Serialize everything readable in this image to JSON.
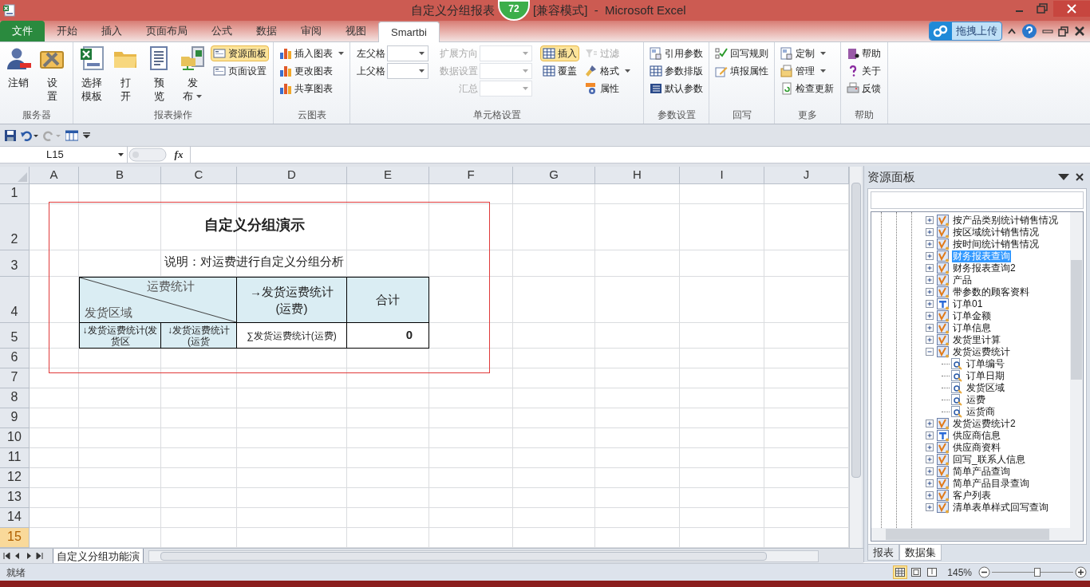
{
  "window": {
    "title": "自定义分组报表",
    "badge": "72",
    "title_rest": "[兼容模式]  -  Microsoft Excel"
  },
  "ribbon": {
    "tabs": [
      {
        "label": "文件",
        "kind": "file",
        "selected": false
      },
      {
        "label": "开始",
        "kind": "tab",
        "selected": false
      },
      {
        "label": "插入",
        "kind": "tab",
        "selected": false
      },
      {
        "label": "页面布局",
        "kind": "tab",
        "selected": false
      },
      {
        "label": "公式",
        "kind": "tab",
        "selected": false
      },
      {
        "label": "数据",
        "kind": "tab",
        "selected": false
      },
      {
        "label": "审阅",
        "kind": "tab",
        "selected": false
      },
      {
        "label": "视图",
        "kind": "tab",
        "selected": false
      },
      {
        "label": "Smartbi",
        "kind": "tab",
        "selected": true
      }
    ],
    "upload_button": "拖拽上传",
    "groups": [
      {
        "label": "服务器",
        "columns": [
          {
            "kind": "large",
            "lines": [
              "注销"
            ],
            "dropdown": false
          },
          {
            "kind": "large",
            "lines": [
              "设",
              "置"
            ],
            "dropdown": false
          }
        ]
      },
      {
        "label": "报表操作",
        "columns": [
          {
            "kind": "large",
            "lines": [
              "选择",
              "模板"
            ],
            "dropdown": false
          },
          {
            "kind": "large",
            "lines": [
              "打",
              "开"
            ],
            "dropdown": false
          },
          {
            "kind": "large",
            "lines": [
              "预",
              "览"
            ],
            "dropdown": false
          },
          {
            "kind": "large",
            "lines": [
              "发",
              "布"
            ],
            "dropdown": true
          },
          {
            "kind": "stack",
            "items": [
              {
                "label": "资源面板",
                "selected": true,
                "disabled": false,
                "dropdown": false
              },
              {
                "label": "页面设置",
                "selected": false,
                "disabled": false,
                "dropdown": false
              }
            ]
          }
        ]
      },
      {
        "label": "云图表",
        "columns": [
          {
            "kind": "stack",
            "items": [
              {
                "label": "插入图表",
                "selected": false,
                "disabled": false,
                "dropdown": true
              },
              {
                "label": "更改图表",
                "selected": false,
                "disabled": false,
                "dropdown": false
              },
              {
                "label": "共享图表",
                "selected": false,
                "disabled": false,
                "dropdown": false
              }
            ]
          }
        ]
      },
      {
        "label": "单元格设置",
        "columns": [
          {
            "kind": "fields",
            "items": [
              {
                "label": "左父格",
                "disabled": false
              },
              {
                "label": "上父格",
                "disabled": false
              }
            ]
          },
          {
            "kind": "fields",
            "items": [
              {
                "label": "扩展方向",
                "disabled": true
              },
              {
                "label": "数据设置",
                "disabled": true
              },
              {
                "label": "汇总",
                "disabled": true
              }
            ]
          },
          {
            "kind": "stack",
            "items": [
              {
                "label": "插入",
                "selected": true,
                "disabled": false,
                "dropdown": false
              },
              {
                "label": "覆盖",
                "selected": false,
                "disabled": false,
                "dropdown": false
              }
            ]
          },
          {
            "kind": "stack",
            "items": [
              {
                "label": "过滤",
                "selected": false,
                "disabled": true,
                "dropdown": false
              },
              {
                "label": "格式",
                "selected": false,
                "disabled": false,
                "dropdown": true
              },
              {
                "label": "属性",
                "selected": false,
                "disabled": false,
                "dropdown": false
              }
            ]
          }
        ]
      },
      {
        "label": "参数设置",
        "columns": [
          {
            "kind": "stack",
            "items": [
              {
                "label": "引用参数",
                "selected": false,
                "disabled": false,
                "dropdown": false
              },
              {
                "label": "参数排版",
                "selected": false,
                "disabled": false,
                "dropdown": false
              },
              {
                "label": "默认参数",
                "selected": false,
                "disabled": false,
                "dropdown": false
              }
            ]
          }
        ]
      },
      {
        "label": "回写",
        "columns": [
          {
            "kind": "stack",
            "items": [
              {
                "label": "回写规则",
                "selected": false,
                "disabled": false,
                "dropdown": false
              },
              {
                "label": "填报属性",
                "selected": false,
                "disabled": false,
                "dropdown": false
              }
            ]
          }
        ]
      },
      {
        "label": "更多",
        "columns": [
          {
            "kind": "stack",
            "items": [
              {
                "label": "定制",
                "selected": false,
                "disabled": false,
                "dropdown": true
              },
              {
                "label": "管理",
                "selected": false,
                "disabled": false,
                "dropdown": true
              },
              {
                "label": "检查更新",
                "selected": false,
                "disabled": false,
                "dropdown": false
              }
            ]
          }
        ]
      },
      {
        "label": "帮助",
        "columns": [
          {
            "kind": "stack",
            "items": [
              {
                "label": "帮助",
                "selected": false,
                "disabled": false,
                "dropdown": false
              },
              {
                "label": "关于",
                "selected": false,
                "disabled": false,
                "dropdown": false
              },
              {
                "label": "反馈",
                "selected": false,
                "disabled": false,
                "dropdown": false
              }
            ]
          }
        ]
      }
    ]
  },
  "formula_bar": {
    "name_box": "L15",
    "function_label": "fx"
  },
  "sheet": {
    "columns": [
      {
        "label": "A",
        "selected": false
      },
      {
        "label": "B",
        "selected": false
      },
      {
        "label": "C",
        "selected": false
      },
      {
        "label": "D",
        "selected": false
      },
      {
        "label": "E",
        "selected": false
      },
      {
        "label": "F",
        "selected": false
      },
      {
        "label": "G",
        "selected": false
      },
      {
        "label": "H",
        "selected": false
      },
      {
        "label": "I",
        "selected": false
      },
      {
        "label": "J",
        "selected": false
      }
    ],
    "rows": [
      {
        "label": "1",
        "selected": false
      },
      {
        "label": "2",
        "selected": false
      },
      {
        "label": "3",
        "selected": false
      },
      {
        "label": "4",
        "selected": false
      },
      {
        "label": "5",
        "selected": false
      },
      {
        "label": "6",
        "selected": false
      },
      {
        "label": "7",
        "selected": false
      },
      {
        "label": "8",
        "selected": false
      },
      {
        "label": "9",
        "selected": false
      },
      {
        "label": "10",
        "selected": false
      },
      {
        "label": "11",
        "selected": false
      },
      {
        "label": "12",
        "selected": false
      },
      {
        "label": "13",
        "selected": false
      },
      {
        "label": "14",
        "selected": false
      },
      {
        "label": "15",
        "selected": true
      }
    ],
    "report": {
      "title": "自定义分组演示",
      "note": "说明：对运费进行自定义分组分析",
      "diagonal_top": "运费统计",
      "diagonal_bottom": "发货区域",
      "column_header": "→发货运费统计(运费)",
      "total_header": "合计",
      "cells": [
        "↓发货运费统计(发货区",
        "↓发货运费统计(运货",
        "∑发货运费统计(运费)",
        "0"
      ]
    }
  },
  "sheet_tabs": [
    {
      "label": "自定义分组功能演",
      "selected": true
    }
  ],
  "resource_panel": {
    "title": "资源面板",
    "tree": [
      {
        "label": "按产品类别统计销售情况",
        "kind": "query",
        "selected": false,
        "expanded": false
      },
      {
        "label": "按区域统计销售情况",
        "kind": "query",
        "selected": false,
        "expanded": false
      },
      {
        "label": "按时间统计销售情况",
        "kind": "query",
        "selected": false,
        "expanded": false
      },
      {
        "label": "财务报表查询",
        "kind": "query",
        "selected": true,
        "expanded": false
      },
      {
        "label": "财务报表查询2",
        "kind": "query",
        "selected": false,
        "expanded": false
      },
      {
        "label": "产品",
        "kind": "query",
        "selected": false,
        "expanded": false
      },
      {
        "label": "带参数的顾客资料",
        "kind": "query",
        "selected": false,
        "expanded": false
      },
      {
        "label": "订单01",
        "kind": "text",
        "selected": false,
        "expanded": false
      },
      {
        "label": "订单金额",
        "kind": "query",
        "selected": false,
        "expanded": false
      },
      {
        "label": "订单信息",
        "kind": "query",
        "selected": false,
        "expanded": false
      },
      {
        "label": "发货里计算",
        "kind": "query",
        "selected": false,
        "expanded": false
      },
      {
        "label": "发货运费统计",
        "kind": "query",
        "selected": false,
        "expanded": true,
        "children": [
          {
            "label": "订单编号",
            "kind": "field",
            "selected": false
          },
          {
            "label": "订单日期",
            "kind": "field",
            "selected": false
          },
          {
            "label": "发货区域",
            "kind": "field",
            "selected": false
          },
          {
            "label": "运费",
            "kind": "field",
            "selected": false
          },
          {
            "label": "运货商",
            "kind": "field",
            "selected": false
          }
        ]
      },
      {
        "label": "发货运费统计2",
        "kind": "query",
        "selected": false,
        "expanded": false
      },
      {
        "label": "供应商信息",
        "kind": "text",
        "selected": false,
        "expanded": false
      },
      {
        "label": "供应商资料",
        "kind": "query",
        "selected": false,
        "expanded": false
      },
      {
        "label": "回写_联系人信息",
        "kind": "query",
        "selected": false,
        "expanded": false
      },
      {
        "label": "简单产品查询",
        "kind": "query",
        "selected": false,
        "expanded": false
      },
      {
        "label": "简单产品目录查询",
        "kind": "query",
        "selected": false,
        "expanded": false
      },
      {
        "label": "客户列表",
        "kind": "query",
        "selected": false,
        "expanded": false
      },
      {
        "label": "清单表单样式回写查询",
        "kind": "query",
        "selected": false,
        "expanded": false
      }
    ],
    "tabs": [
      {
        "label": "报表",
        "selected": false
      },
      {
        "label": "数据集",
        "selected": true
      }
    ]
  },
  "status_bar": {
    "text": "就绪",
    "views": [
      {
        "selected": true
      },
      {
        "selected": false
      },
      {
        "selected": false
      }
    ],
    "zoom": "145%",
    "zoom_slider": {
      "level": 0.56
    }
  }
}
